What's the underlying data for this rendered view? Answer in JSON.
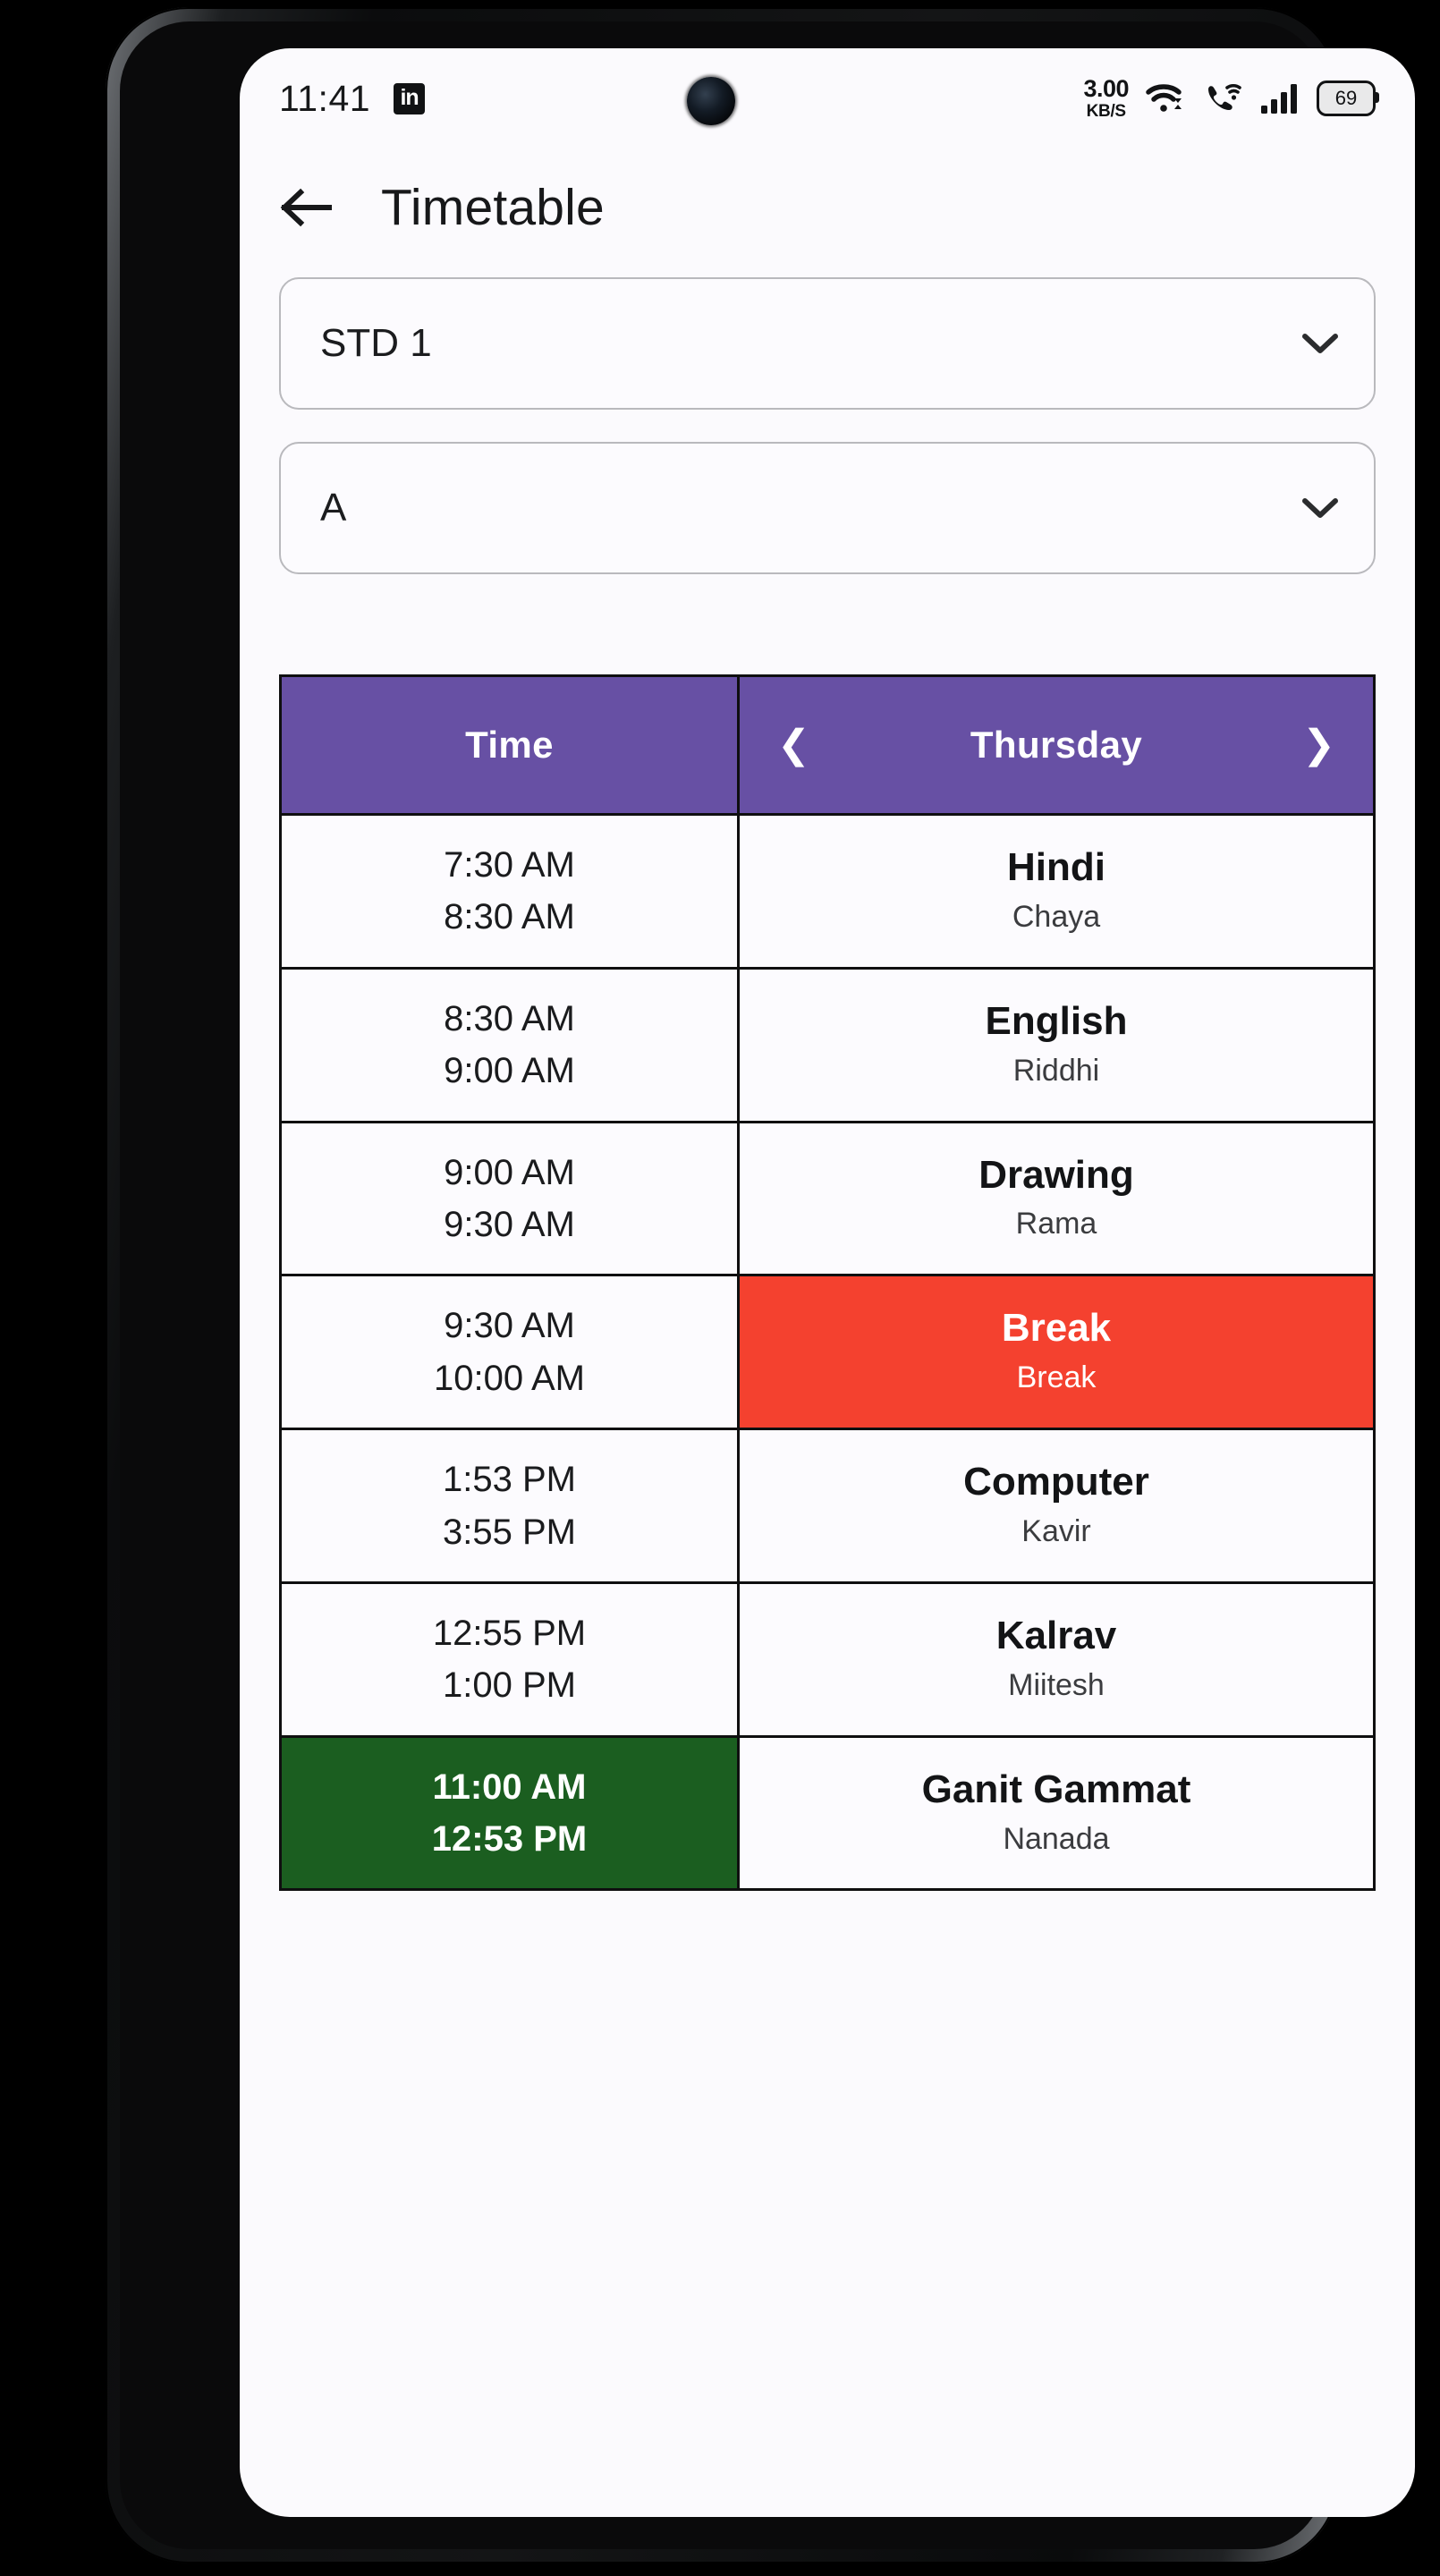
{
  "status_bar": {
    "time": "11:41",
    "app_icon": "linkedin-icon",
    "network_speed_value": "3.00",
    "network_speed_unit": "KB/S",
    "wifi_icon": "wifi-icon",
    "wifi_calling_icon": "wifi-calling-icon",
    "signal_icon": "signal-bars-icon",
    "battery_level": "69"
  },
  "app_bar": {
    "back_icon": "back-arrow-icon",
    "title": "Timetable"
  },
  "filters": [
    {
      "name": "standard",
      "value": "STD 1",
      "icon": "chevron-down-icon"
    },
    {
      "name": "division",
      "value": "A",
      "icon": "chevron-down-icon"
    }
  ],
  "timetable": {
    "header": {
      "time_label": "Time",
      "day_label": "Thursday",
      "prev_icon": "chevron-left-icon",
      "next_icon": "chevron-right-icon"
    },
    "rows": [
      {
        "start": "7:30 AM",
        "end": "8:30 AM",
        "subject": "Hindi",
        "teacher": "Chaya",
        "time_style": "default",
        "subject_style": "default"
      },
      {
        "start": "8:30 AM",
        "end": "9:00 AM",
        "subject": "English",
        "teacher": "Riddhi",
        "time_style": "default",
        "subject_style": "default"
      },
      {
        "start": "9:00 AM",
        "end": "9:30 AM",
        "subject": "Drawing",
        "teacher": "Rama",
        "time_style": "default",
        "subject_style": "default"
      },
      {
        "start": "9:30 AM",
        "end": "10:00 AM",
        "subject": "Break",
        "teacher": "Break",
        "time_style": "default",
        "subject_style": "break"
      },
      {
        "start": "1:53 PM",
        "end": "3:55 PM",
        "subject": "Computer",
        "teacher": "Kavir",
        "time_style": "default",
        "subject_style": "default"
      },
      {
        "start": "12:55 PM",
        "end": "1:00 PM",
        "subject": "Kalrav",
        "teacher": "Miitesh",
        "time_style": "default",
        "subject_style": "default"
      },
      {
        "start": "11:00 AM",
        "end": "12:53 PM",
        "subject": "Ganit Gammat",
        "teacher": "Nanada",
        "time_style": "green",
        "subject_style": "default"
      }
    ]
  },
  "colors": {
    "header_purple": "#6750a4",
    "break_red": "#f4412f",
    "highlight_green": "#1b5e20",
    "screen_background": "#fbfafd",
    "text_primary": "#17181a"
  }
}
